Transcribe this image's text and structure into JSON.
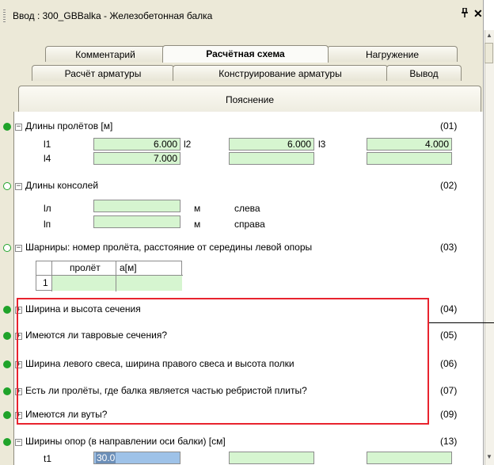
{
  "window": {
    "title": "Ввод : 300_GBBalka - Железобетонная балка",
    "pin_glyph": "ᵖ",
    "close_glyph": "✕"
  },
  "tabs": {
    "row1": [
      "Комментарий",
      "Расчётная схема",
      "Нагружение"
    ],
    "row2": [
      "Расчёт арматуры",
      "Конструирование арматуры",
      "Вывод"
    ],
    "row3": [
      "Пояснение"
    ],
    "active": "Расчётная схема"
  },
  "sections": {
    "spans": {
      "label": "Длины пролётов [м]",
      "code": "(01)",
      "l1_label": "l1",
      "l1": "6.000",
      "l2_label": "l2",
      "l2": "6.000",
      "l3_label": "l3",
      "l3": "4.000",
      "l4_label": "l4",
      "l4": "7.000"
    },
    "consoles": {
      "label": "Длины консолей",
      "code": "(02)",
      "ll_label": "lл",
      "lp_label": "lп",
      "unit": "м",
      "left": "слева",
      "right": "справа"
    },
    "hinges": {
      "label": "Шарниры: номер пролёта, расстояние от середины левой опоры",
      "code": "(03)",
      "col_span": "пролёт",
      "col_a": "a[м]",
      "row1": "1"
    },
    "collapsed": [
      {
        "label": "Ширина и высота сечения",
        "code": "(04)"
      },
      {
        "label": "Имеются ли тавровые сечения?",
        "code": "(05)"
      },
      {
        "label": "Ширина левого свеса, ширина правого свеса и высота полки",
        "code": "(06)"
      },
      {
        "label": "Есть ли пролёты, где балка является частью ребристой плиты?",
        "code": "(07)"
      },
      {
        "label": "Имеются ли вуты?",
        "code": "(09)"
      }
    ],
    "supports": {
      "label": "Ширины опор (в направлении оси балки) [см]",
      "code": "(13)",
      "t1_label": "t1",
      "t1": "30.0"
    }
  },
  "colors": {
    "accent_green": "#1fa32a",
    "field_green": "#d6f5d0",
    "highlight_red": "#e8232e",
    "selection_blue": "#9ec2e8"
  }
}
